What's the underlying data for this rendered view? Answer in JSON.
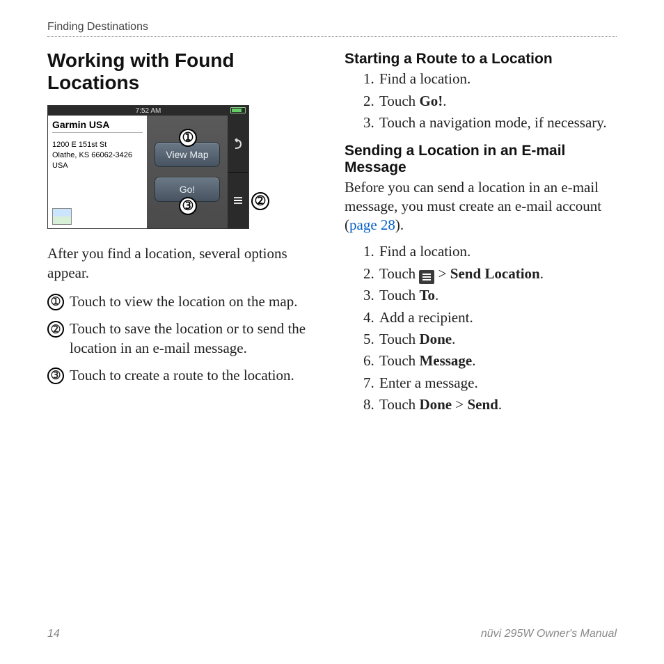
{
  "section_header": "Finding Destinations",
  "left": {
    "heading": "Working with Found Locations",
    "device": {
      "time": "7:52 AM",
      "location_title": "Garmin USA",
      "address_line1": "1200 E 151st St",
      "address_line2": "Olathe, KS 66062-3426",
      "address_line3": "USA",
      "btn_view_map": "View Map",
      "btn_go": "Go!"
    },
    "intro": "After you find a location, several options appear.",
    "callouts": {
      "n1": "➀",
      "n2": "➁",
      "n3": "➂",
      "t1": "Touch to view the location on the map.",
      "t2": "Touch to save the location or to send the location in an e-mail message.",
      "t3": "Touch to create a route to the location."
    }
  },
  "right": {
    "h_start": "Starting a Route to a Location",
    "start_steps": {
      "s1": "Find a location.",
      "s2a": "Touch ",
      "s2b": "Go!",
      "s2c": ".",
      "s3": "Touch a navigation mode, if necessary."
    },
    "h_email": "Sending a Location in an E-mail Message",
    "email_before_a": "Before you can send a location in an e-mail message, you must create an e-mail account (",
    "email_before_link": "page 28",
    "email_before_b": ").",
    "email_steps": {
      "s1": "Find a location.",
      "s2a": "Touch ",
      "s2b": " > ",
      "s2c": "Send Location",
      "s2d": ".",
      "s3a": "Touch ",
      "s3b": "To",
      "s3c": ".",
      "s4": "Add a recipient.",
      "s5a": "Touch ",
      "s5b": "Done",
      "s5c": ".",
      "s6a": "Touch ",
      "s6b": "Message",
      "s6c": ".",
      "s7": "Enter a message.",
      "s8a": "Touch ",
      "s8b": "Done",
      "s8c": " > ",
      "s8d": "Send",
      "s8e": "."
    }
  },
  "footer": {
    "page": "14",
    "manual": "nüvi 295W Owner's Manual"
  }
}
